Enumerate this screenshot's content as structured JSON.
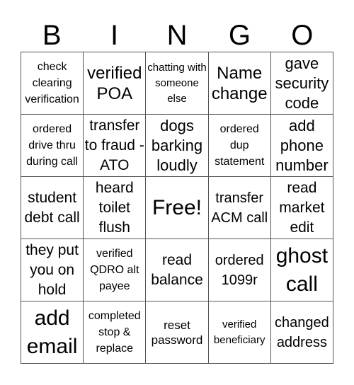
{
  "header": [
    "B",
    "I",
    "N",
    "G",
    "O"
  ],
  "cells": [
    [
      "check clearing verification",
      "verified POA",
      "chatting with someone else",
      "Name change",
      "gave security code"
    ],
    [
      "ordered drive thru during call",
      "transfer to fraud - ATO",
      "dogs barking loudly",
      "ordered dup statement",
      "add phone number"
    ],
    [
      "student debt call",
      "heard toilet flush",
      "Free!",
      "transfer ACM call",
      "read market edit"
    ],
    [
      "they put you on hold",
      "verified QDRO alt payee",
      "read balance",
      "ordered 1099r",
      "ghost call"
    ],
    [
      "add email",
      "completed stop & replace",
      "reset password",
      "verified beneficiary",
      "changed address"
    ]
  ]
}
